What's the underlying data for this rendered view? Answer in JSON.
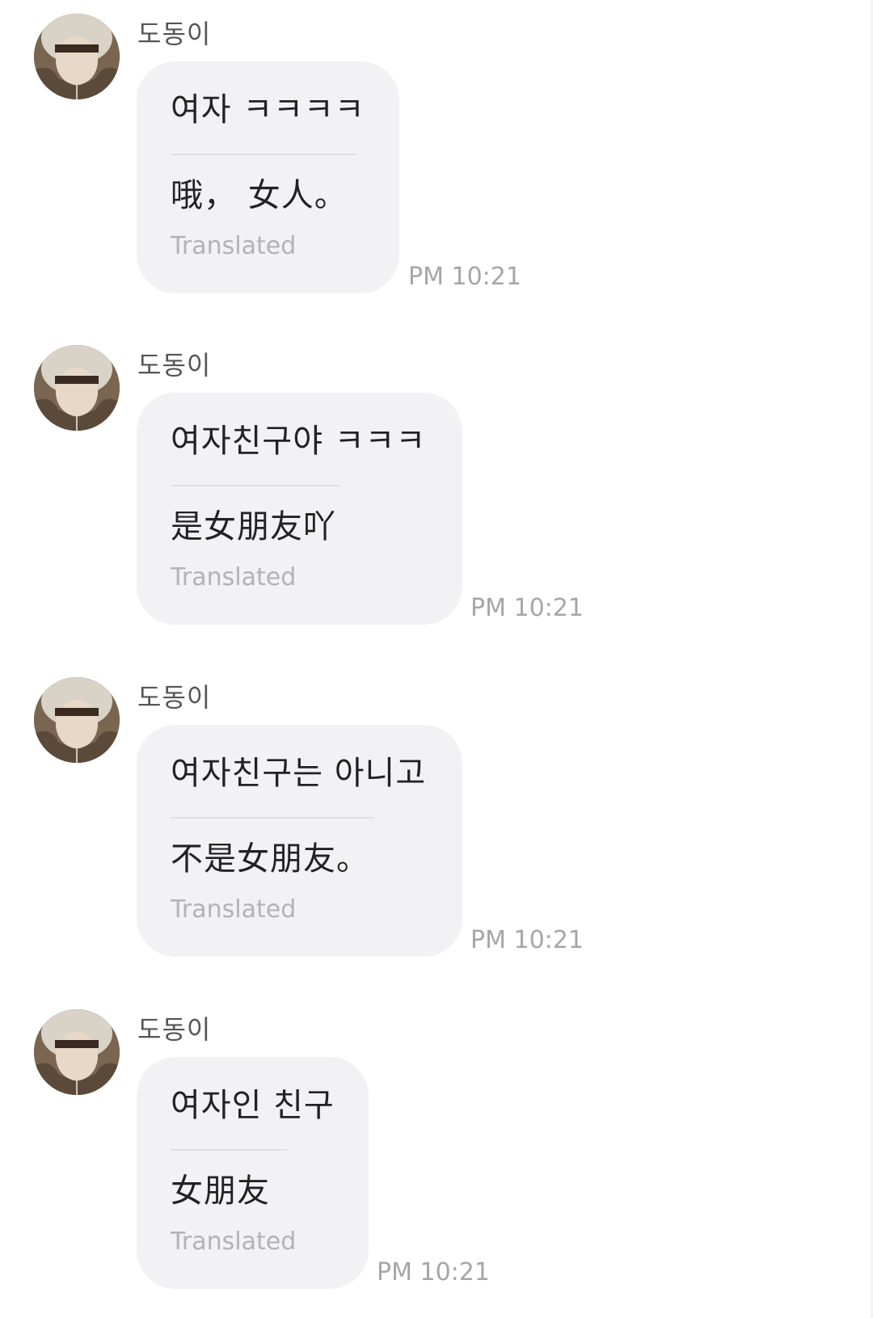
{
  "messages": [
    {
      "sender": "도동이",
      "original": "여자 ㅋㅋㅋㅋ",
      "translation": "哦， 女人。",
      "translated_label": "Translated",
      "time": "PM 10:21"
    },
    {
      "sender": "도동이",
      "original": "여자친구야 ㅋㅋㅋ",
      "translation": "是女朋友吖",
      "translated_label": "Translated",
      "time": "PM 10:21"
    },
    {
      "sender": "도동이",
      "original": "여자친구는 아니고",
      "translation": "不是女朋友。",
      "translated_label": "Translated",
      "time": "PM 10:21"
    },
    {
      "sender": "도동이",
      "original": "여자인 친구",
      "translation": "女朋友",
      "translated_label": "Translated",
      "time": "PM 10:21"
    }
  ],
  "colors": {
    "bubble_bg": "#f2f2f5",
    "timestamp": "#a6a6aa",
    "translated_label": "#b3b3b7"
  }
}
